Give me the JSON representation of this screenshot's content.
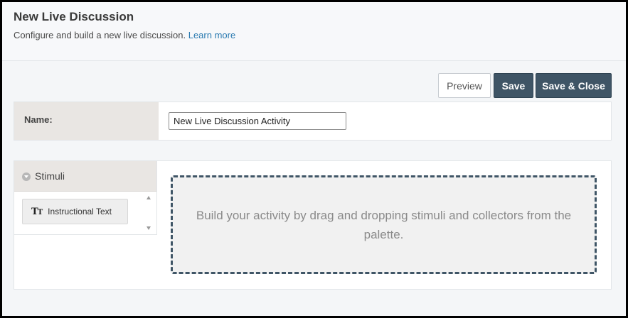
{
  "header": {
    "title": "New Live Discussion",
    "subtitle": "Configure and build a new live discussion.",
    "learn_more": "Learn more"
  },
  "toolbar": {
    "preview_label": "Preview",
    "save_label": "Save",
    "save_close_label": "Save & Close"
  },
  "name_field": {
    "label": "Name:",
    "value": "New Live Discussion Activity"
  },
  "palette": {
    "section_title": "Stimuli",
    "items": [
      {
        "icon": "text-format-icon",
        "label": "Instructional Text"
      }
    ]
  },
  "canvas": {
    "placeholder": "Build your activity by drag and dropping stimuli and collectors from the palette."
  },
  "colors": {
    "primary_button": "#3f5566",
    "link": "#2a7ab0",
    "label_cell": "#e9e6e3"
  }
}
